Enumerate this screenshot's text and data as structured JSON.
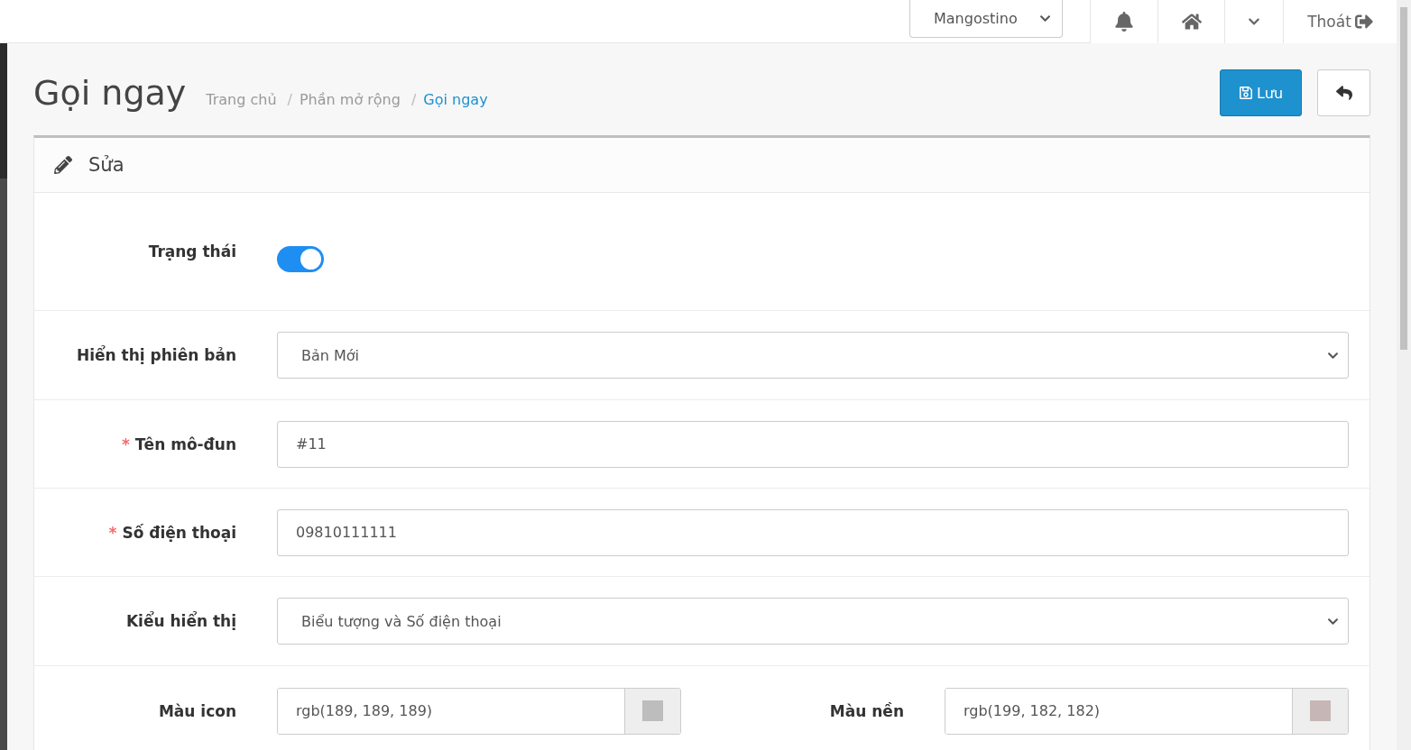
{
  "topbar": {
    "store_select": {
      "value": "Mangostino"
    },
    "logout": "Thoát"
  },
  "page": {
    "title": "Gọi ngay",
    "breadcrumb": [
      {
        "label": "Trang chủ",
        "current": false
      },
      {
        "separator": "/",
        "label": "Phần mở rộng",
        "current": false
      },
      {
        "separator": "/",
        "label": "Gọi ngay",
        "current": true
      }
    ],
    "save_button": "Lưu"
  },
  "panel": {
    "title": "Sửa",
    "fields": [
      {
        "kind": "toggle",
        "label": "Trạng thái",
        "on": true
      },
      {
        "kind": "select",
        "label": "Hiển thị phiên bản",
        "value": "Bản Mới"
      },
      {
        "kind": "text",
        "required_mark": "*",
        "label": "Tên mô-đun",
        "value": "#11"
      },
      {
        "kind": "text",
        "required_mark": "*",
        "label": "Số điện thoại",
        "value": "09810111111"
      },
      {
        "kind": "select",
        "label": "Kiểu hiển thị",
        "value": "Biểu tượng và Số điện thoại"
      },
      {
        "kind": "colors",
        "items": [
          {
            "label": "Màu icon",
            "value": "rgb(189, 189, 189)",
            "color": "#bdbdbd"
          },
          {
            "label": "Màu nền",
            "value": "rgb(199, 182, 182)",
            "color": "#c7b6b6"
          }
        ]
      }
    ]
  }
}
